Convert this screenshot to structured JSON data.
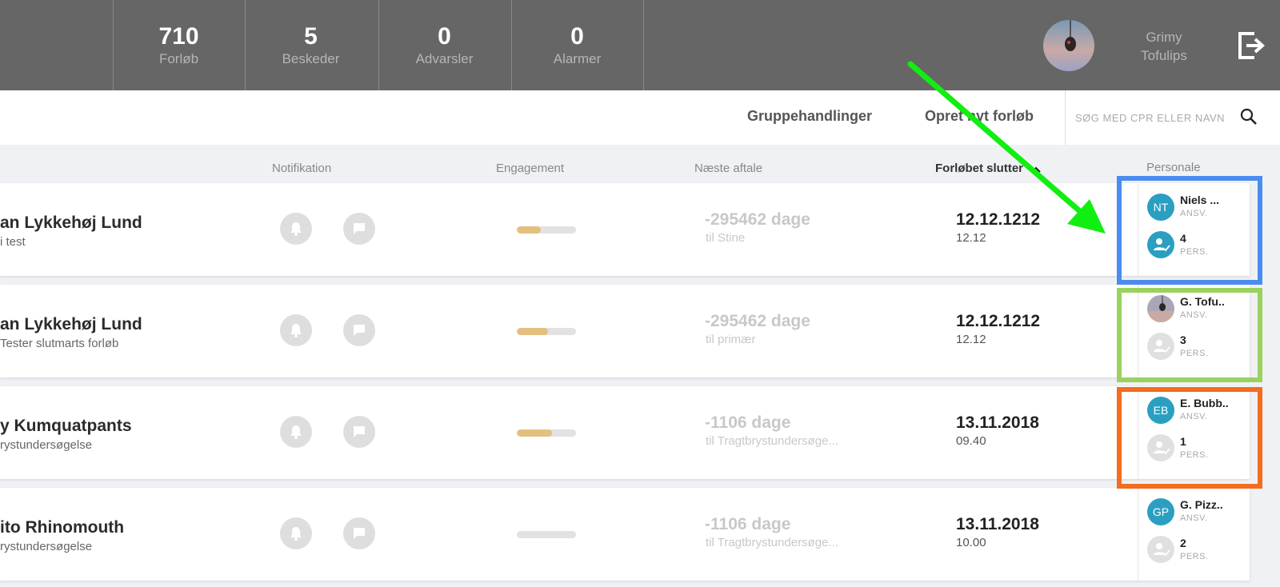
{
  "stats": [
    {
      "value": "710",
      "label": "Forløb"
    },
    {
      "value": "5",
      "label": "Beskeder"
    },
    {
      "value": "0",
      "label": "Advarsler"
    },
    {
      "value": "0",
      "label": "Alarmer"
    }
  ],
  "user": {
    "first": "Grimy",
    "last": "Tofulips"
  },
  "actions": {
    "group": "Gruppehandlinger",
    "create": "Opret nyt forløb"
  },
  "search": {
    "placeholder": "SØG MED CPR ELLER NAVN"
  },
  "columns": {
    "notification": "Notifikation",
    "engagement": "Engagement",
    "next": "Næste aftale",
    "ends": "Forløbet slutter",
    "staff": "Personale"
  },
  "rows": [
    {
      "name": "an Lykkehøj Lund",
      "sub": "i test",
      "engagement": 0.4,
      "days": "-295462 dage",
      "to": "til Stine",
      "date": "12.12.1212",
      "time": "12.12",
      "staff1": {
        "initials": "NT",
        "name": "Niels ...",
        "role": "ANSV."
      },
      "staff2": {
        "count": "4",
        "role": "PERS."
      }
    },
    {
      "name": "an Lykkehøj Lund",
      "sub": "Tester slutmarts forløb",
      "engagement": 0.53,
      "days": "-295462 dage",
      "to": "til primær",
      "date": "12.12.1212",
      "time": "12.12",
      "staff1": {
        "initials": "",
        "name": "G. Tofu..",
        "role": "ANSV."
      },
      "staff2": {
        "count": "3",
        "role": "PERS."
      }
    },
    {
      "name": "y Kumquatpants",
      "sub": "rystundersøgelse",
      "engagement": 0.6,
      "days": "-1106 dage",
      "to": "til Tragtbrystundersøge...",
      "date": "13.11.2018",
      "time": "09.40",
      "staff1": {
        "initials": "EB",
        "name": "E. Bubb..",
        "role": "ANSV."
      },
      "staff2": {
        "count": "1",
        "role": "PERS."
      }
    },
    {
      "name": "ito Rhinomouth",
      "sub": "rystundersøgelse",
      "engagement": 0,
      "days": "-1106 dage",
      "to": "til Tragtbrystundersøge...",
      "date": "13.11.2018",
      "time": "10.00",
      "staff1": {
        "initials": "GP",
        "name": "G. Pizz..",
        "role": "ANSV."
      },
      "staff2": {
        "count": "2",
        "role": "PERS."
      }
    }
  ],
  "colors": {
    "topbar": "#666666",
    "accent": "#2a9fc1",
    "engagement": "#e3c080",
    "blue_box": "#4a8cf0",
    "green_box": "#9bd15e",
    "orange_box": "#f36d1e",
    "arrow": "#11ee11"
  },
  "icons": [
    "logout-icon",
    "search-icon",
    "bell-icon",
    "chat-icon",
    "person-check-icon",
    "sort-up-icon"
  ]
}
